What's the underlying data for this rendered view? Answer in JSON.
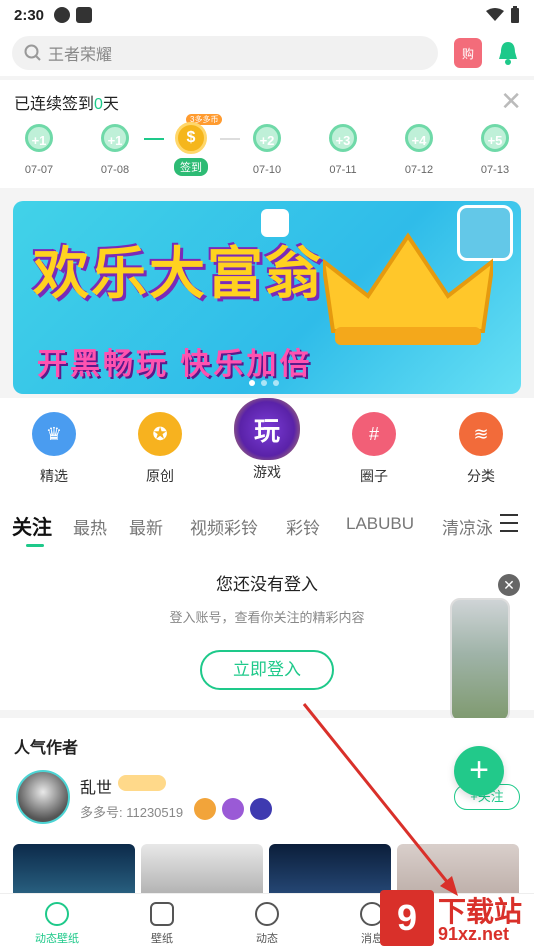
{
  "status_bar": {
    "time": "2:30"
  },
  "search": {
    "placeholder": "王者荣耀",
    "shop_label": "购"
  },
  "checkin": {
    "title_prefix": "已连续签到",
    "title_count": "0",
    "title_suffix": "天",
    "bonus_tag": "3多多币",
    "days": [
      {
        "reward": "+1",
        "date": "07-07"
      },
      {
        "reward": "+1",
        "date": "07-08"
      },
      {
        "reward": "$",
        "date": "签到"
      },
      {
        "reward": "+2",
        "date": "07-10"
      },
      {
        "reward": "+3",
        "date": "07-11"
      },
      {
        "reward": "+4",
        "date": "07-12"
      },
      {
        "reward": "+5",
        "date": "07-13"
      }
    ]
  },
  "banner": {
    "title": "欢乐大富翁",
    "subtitle": "开黑畅玩 快乐加倍"
  },
  "quick_nav": [
    {
      "label": "精选",
      "icon": "crown-icon",
      "color": "#4a9cf0"
    },
    {
      "label": "原创",
      "icon": "original-icon",
      "color": "#f7b21f"
    },
    {
      "label": "游戏",
      "icon": "game-badge-icon",
      "color": "#6a2fc2",
      "glyph": "玩"
    },
    {
      "label": "圈子",
      "icon": "hashtag-icon",
      "color": "#f25f77"
    },
    {
      "label": "分类",
      "icon": "layers-icon",
      "color": "#f26b3a"
    }
  ],
  "tabs": [
    "关注",
    "最热",
    "最新",
    "视频彩铃",
    "彩铃",
    "LABUBU",
    "清凉泳"
  ],
  "login_prompt": {
    "heading": "您还没有登入",
    "sub": "登入账号，查看你关注的精彩内容",
    "button": "立即登入"
  },
  "authors": {
    "heading": "人气作者",
    "name": "乱世",
    "id_label": "多多号: 11230519",
    "follow": "+关注"
  },
  "fab": "+",
  "bottom_nav": [
    {
      "label": "动态壁纸"
    },
    {
      "label": "壁纸"
    },
    {
      "label": "动态"
    },
    {
      "label": "消息"
    }
  ],
  "watermark": {
    "number": "9",
    "text": "下载站",
    "url": "91xz.net"
  },
  "colors": {
    "accent": "#1ec98a",
    "watermark": "#d9302a"
  }
}
